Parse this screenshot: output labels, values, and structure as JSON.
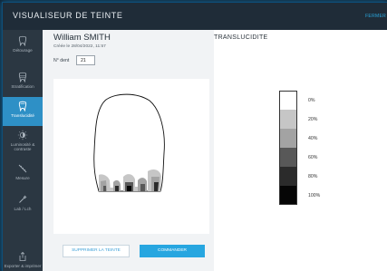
{
  "app": {
    "title": "VISUALISEUR DE TEINTE",
    "close_label": "FERMER"
  },
  "sidebar": {
    "items": [
      {
        "label": "Détourage",
        "icon": "tooth-outline-icon",
        "active": false
      },
      {
        "label": "Stratification",
        "icon": "layers-tooth-icon",
        "active": false
      },
      {
        "label": "Translucidité",
        "icon": "tooth-translucency-icon",
        "active": true
      },
      {
        "label": "Luminosité & contraste",
        "icon": "brightness-icon",
        "active": false
      },
      {
        "label": "Mesure",
        "icon": "ruler-icon",
        "active": false
      },
      {
        "label": "Lab / Lch",
        "icon": "color-picker-icon",
        "active": false
      },
      {
        "label": "Exporter & imprimer",
        "icon": "export-icon",
        "active": false
      }
    ]
  },
  "patient": {
    "name": "William SMITH",
    "created": "Créée le 28/04/2022, 11:57"
  },
  "tooth": {
    "label": "N° dent",
    "value": "21"
  },
  "actions": {
    "delete_label": "SUPPRIMER LA TEINTE",
    "order_label": "COMMANDER"
  },
  "translucency": {
    "title": "TRANSLUCIDITE",
    "levels": [
      {
        "label": "0%",
        "color": "#ffffff"
      },
      {
        "label": "20%",
        "color": "#c6c6c6"
      },
      {
        "label": "40%",
        "color": "#a3a3a3"
      },
      {
        "label": "60%",
        "color": "#585858"
      },
      {
        "label": "80%",
        "color": "#2b2b2b"
      },
      {
        "label": "100%",
        "color": "#060606"
      }
    ]
  },
  "colors": {
    "accent": "#27a6e0",
    "sidebar_active": "#2e90c6",
    "titlebar": "#1f2c38"
  }
}
